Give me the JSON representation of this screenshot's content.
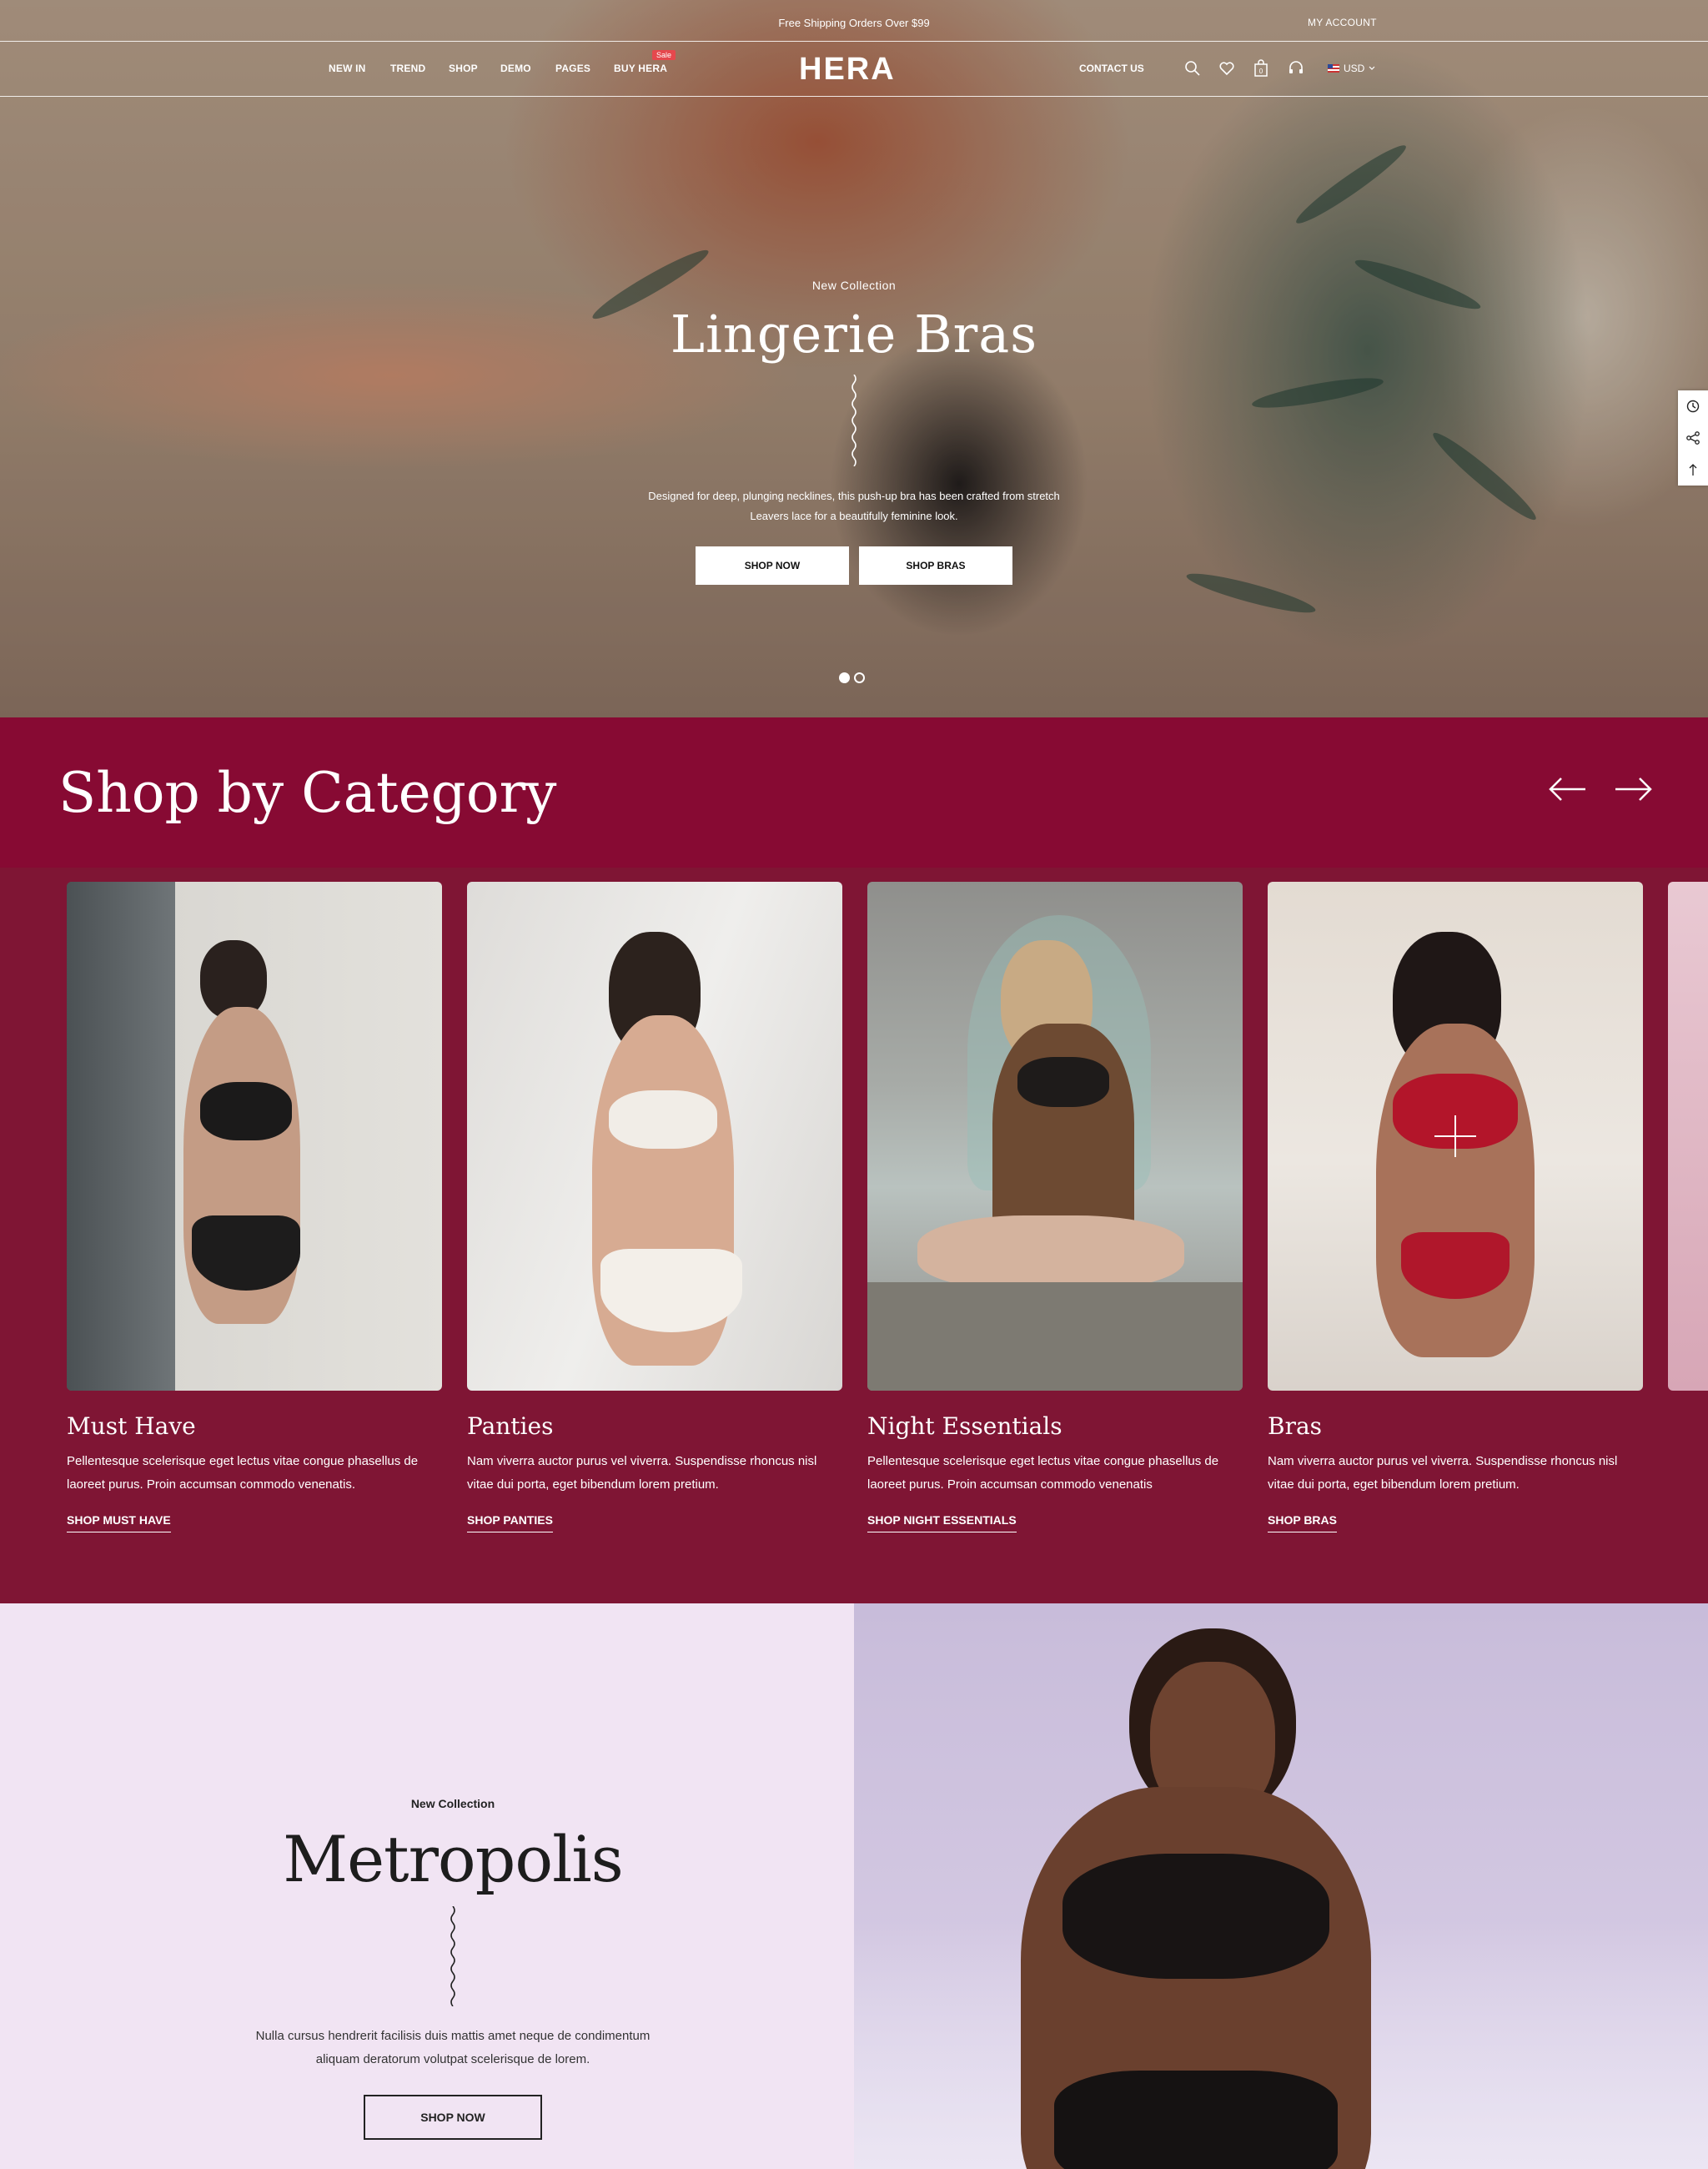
{
  "topbar": {
    "promo": "Free Shipping Orders Over $99",
    "account": "MY ACCOUNT"
  },
  "nav": {
    "menu": [
      "NEW IN",
      "TREND",
      "SHOP",
      "DEMO",
      "PAGES",
      "BUY HERA"
    ],
    "sale_badge": "Sale",
    "logo": "HERA",
    "contact": "CONTACT US",
    "currency": "USD",
    "icons": [
      "search-icon",
      "heart-icon",
      "cart-icon",
      "headset-icon"
    ],
    "cart_count": "0"
  },
  "hero": {
    "eyebrow": "New Collection",
    "title": "Lingerie Bras",
    "description": "Designed for deep, plunging necklines, this push-up bra has been crafted from stretch Leavers lace for a beautifully feminine look.",
    "buttons": [
      "SHOP NOW",
      "SHOP BRAS"
    ],
    "slide_count": 2,
    "active_slide": 1
  },
  "side_tools": [
    "history-icon",
    "share-icon",
    "back-to-top-icon"
  ],
  "categories": {
    "title": "Shop by Category",
    "items": [
      {
        "name": "Must Have",
        "description": "Pellentesque scelerisque eget lectus vitae congue phasellus de laoreet purus. Proin accumsan commodo venenatis.",
        "link": "SHOP MUST  HAVE"
      },
      {
        "name": "Panties",
        "description": "Nam viverra auctor purus vel viverra. Suspendisse rhoncus nisl vitae dui porta, eget bibendum lorem pretium.",
        "link": "SHOP PANTIES"
      },
      {
        "name": "Night Essentials",
        "description": "Pellentesque scelerisque eget lectus vitae congue phasellus de laoreet purus. Proin accumsan commodo venenatis",
        "link": "SHOP NIGHT ESSENTIALS"
      },
      {
        "name": "Bras",
        "description": "Nam viverra auctor purus vel viverra. Suspendisse rhoncus nisl vitae dui porta, eget bibendum lorem pretium.",
        "link": "SHOP BRAS"
      }
    ]
  },
  "metropolis": {
    "eyebrow": "New Collection",
    "title": "Metropolis",
    "description": "Nulla cursus hendrerit facilisis duis mattis amet neque de condimentum aliquam deratorum volutpat scelerisque de lorem.",
    "button": "SHOP NOW"
  },
  "colors": {
    "category_header": "#870a33",
    "category_body": "#7f1534",
    "metro_bg": "#f1e4f3",
    "sale": "#e5484d"
  }
}
